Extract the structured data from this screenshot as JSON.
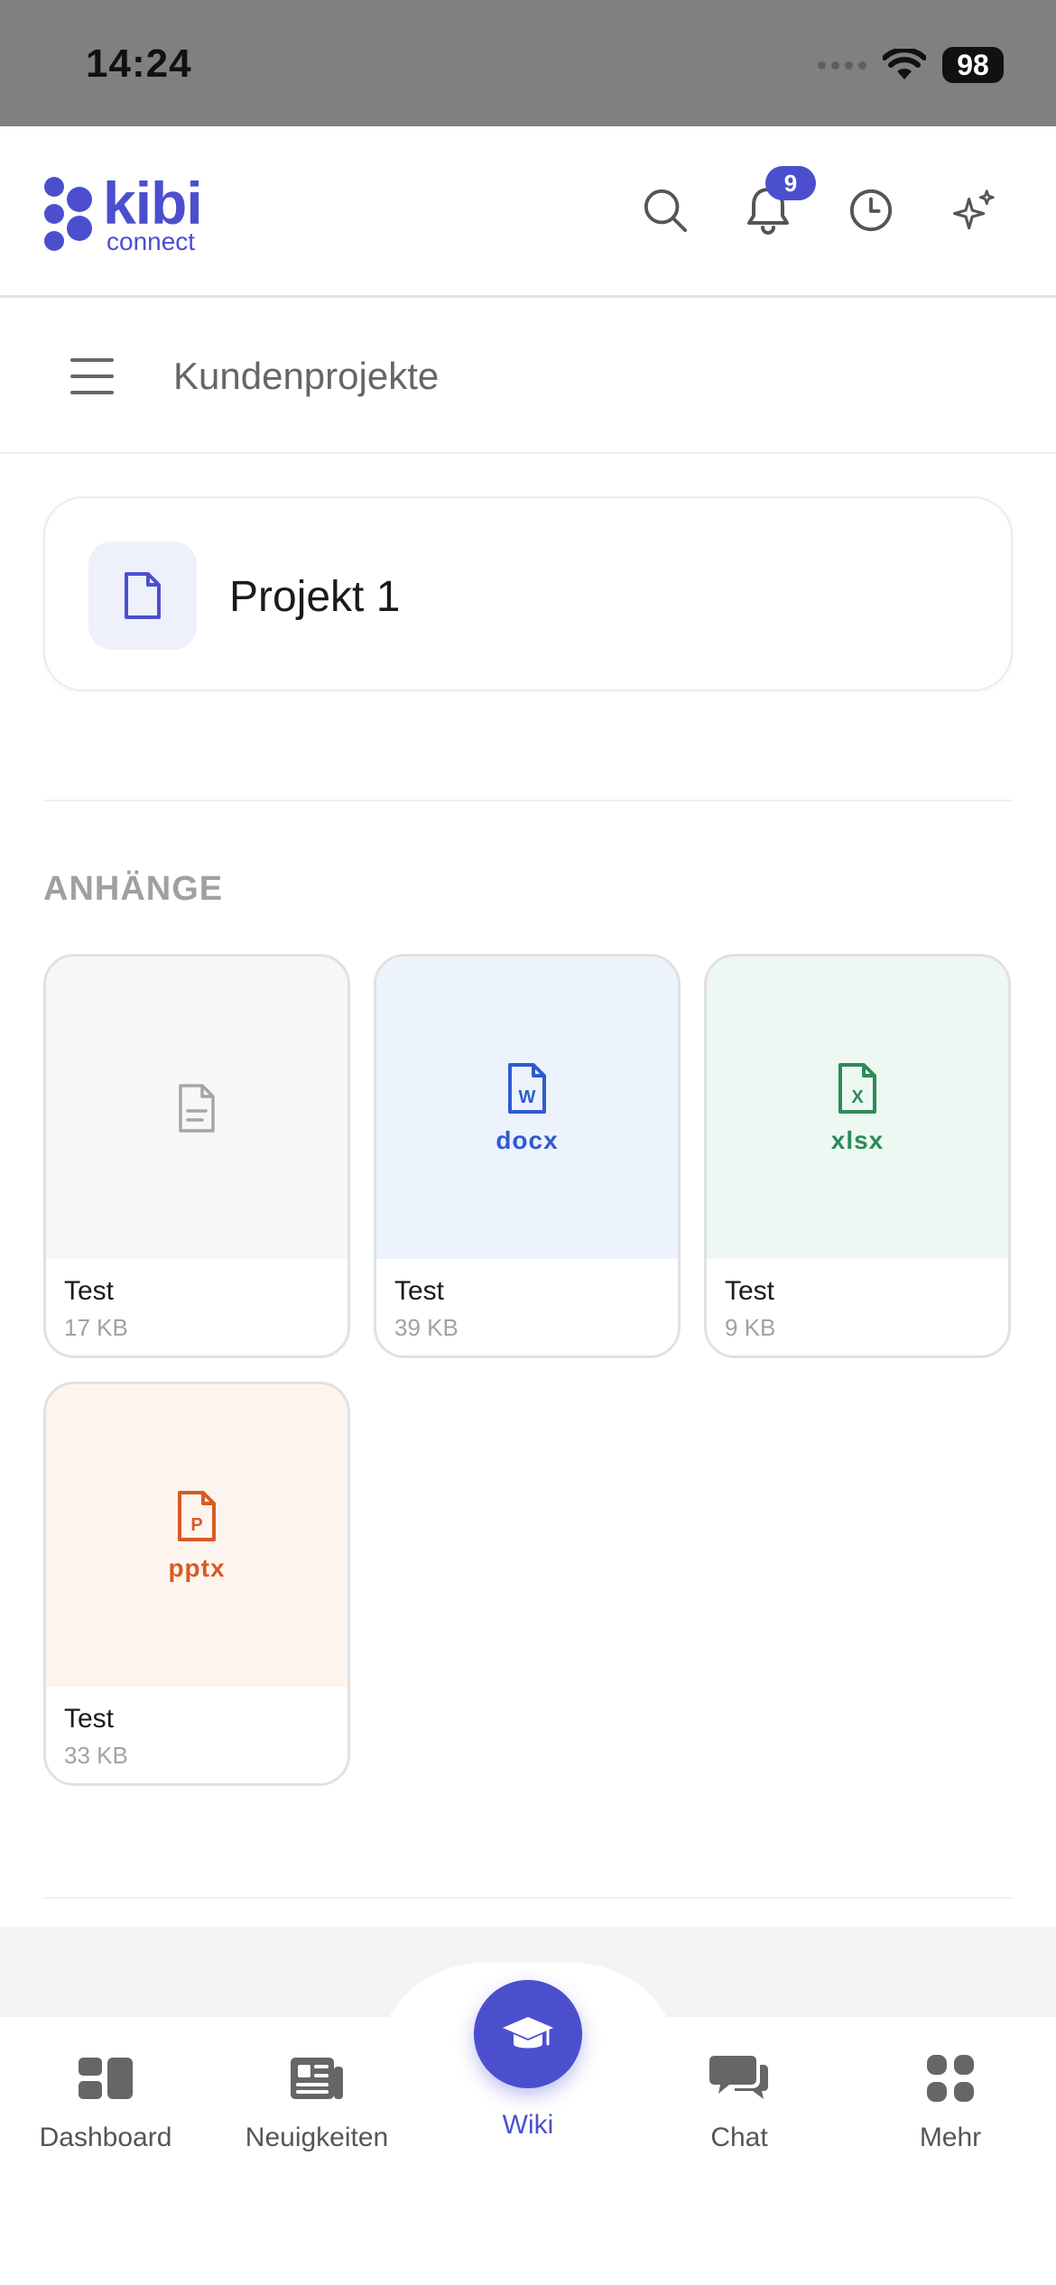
{
  "status_bar": {
    "time": "14:24",
    "battery": "98"
  },
  "header": {
    "logo_main": "kibi",
    "logo_sub": "connect",
    "notification_count": "9"
  },
  "sub_header": {
    "title": "Kundenprojekte"
  },
  "project": {
    "name": "Projekt 1"
  },
  "attachments": {
    "label": "ANHÄNGE",
    "items": [
      {
        "name": "Test",
        "size": "17 KB",
        "ext": "",
        "icon": "generic-file-icon"
      },
      {
        "name": "Test",
        "size": "39 KB",
        "ext": "docx",
        "icon": "word-file-icon"
      },
      {
        "name": "Test",
        "size": "9 KB",
        "ext": "xlsx",
        "icon": "excel-file-icon"
      },
      {
        "name": "Test",
        "size": "33 KB",
        "ext": "pptx",
        "icon": "powerpoint-file-icon"
      }
    ]
  },
  "bottom_nav": {
    "items": [
      {
        "label": "Dashboard"
      },
      {
        "label": "Neuigkeiten"
      },
      {
        "label": "Wiki"
      },
      {
        "label": "Chat"
      },
      {
        "label": "Mehr"
      }
    ],
    "active": "Wiki"
  },
  "colors": {
    "accent": "#4b4fce",
    "docx": "#2f5bd0",
    "xlsx": "#2e8a59",
    "pptx": "#d85a26",
    "status_bar": "#808080"
  }
}
